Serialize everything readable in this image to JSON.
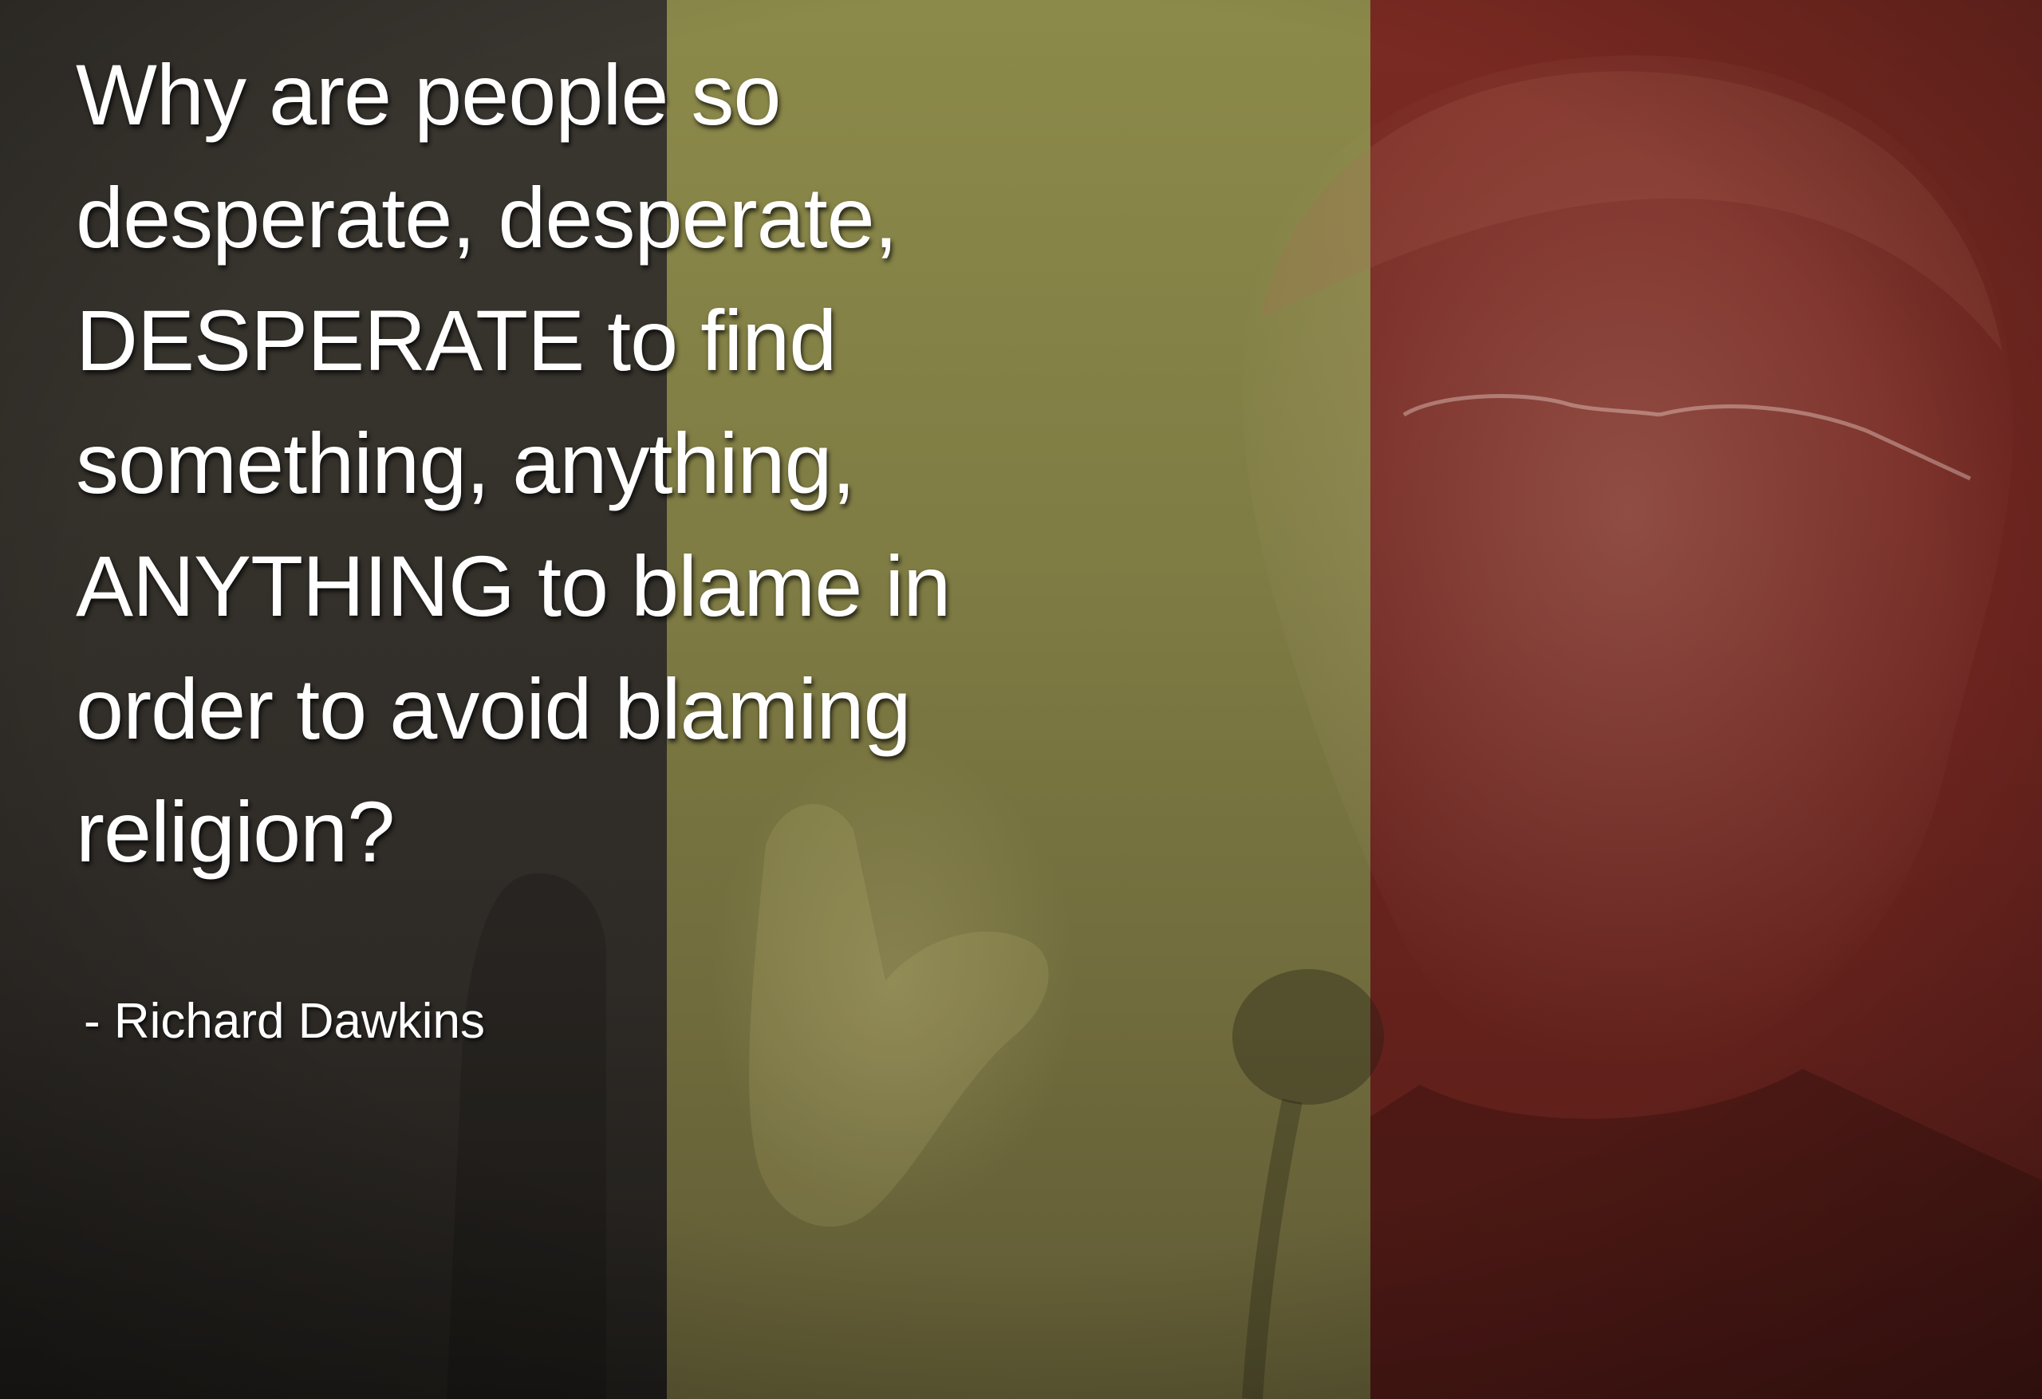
{
  "quote": {
    "lines": [
      "Why are people so",
      "desperate, desperate,",
      "DESPERATE to find",
      "something, anything,",
      "ANYTHING to blame in",
      "order to avoid blaming",
      "religion?"
    ]
  },
  "attribution": "- Richard Dawkins",
  "colors": {
    "band_left": "#35312b",
    "band_middle": "#7f7c44",
    "band_right": "#6f2520",
    "text": "#ffffff"
  }
}
